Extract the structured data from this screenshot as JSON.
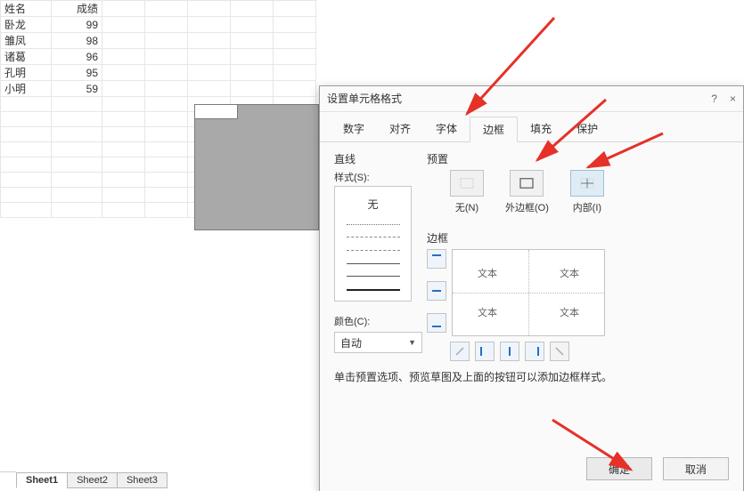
{
  "sheet": {
    "header": {
      "colA": "姓名",
      "colB": "成绩"
    },
    "rows": [
      {
        "name": "卧龙",
        "score": "99"
      },
      {
        "name": "雏凤",
        "score": "98"
      },
      {
        "name": "诸葛",
        "score": "96"
      },
      {
        "name": "孔明",
        "score": "95"
      },
      {
        "name": "小明",
        "score": "59"
      }
    ],
    "tabs": [
      "Sheet1",
      "Sheet2",
      "Sheet3"
    ],
    "active_tab": 0
  },
  "dialog": {
    "title": "设置单元格格式",
    "help": "?",
    "close": "×",
    "tabs": [
      "数字",
      "对齐",
      "字体",
      "边框",
      "填充",
      "保护"
    ],
    "active_tab": 3,
    "line_group": "直线",
    "style_label": "样式(S):",
    "style_none": "无",
    "color_label": "颜色(C):",
    "color_value": "自动",
    "preset_group": "预置",
    "presets": [
      {
        "label": "无(N)"
      },
      {
        "label": "外边框(O)"
      },
      {
        "label": "内部(I)"
      }
    ],
    "border_group": "边框",
    "preview_text": "文本",
    "hint": "单击预置选项、预览草图及上面的按钮可以添加边框样式。",
    "ok": "确定",
    "cancel": "取消"
  }
}
